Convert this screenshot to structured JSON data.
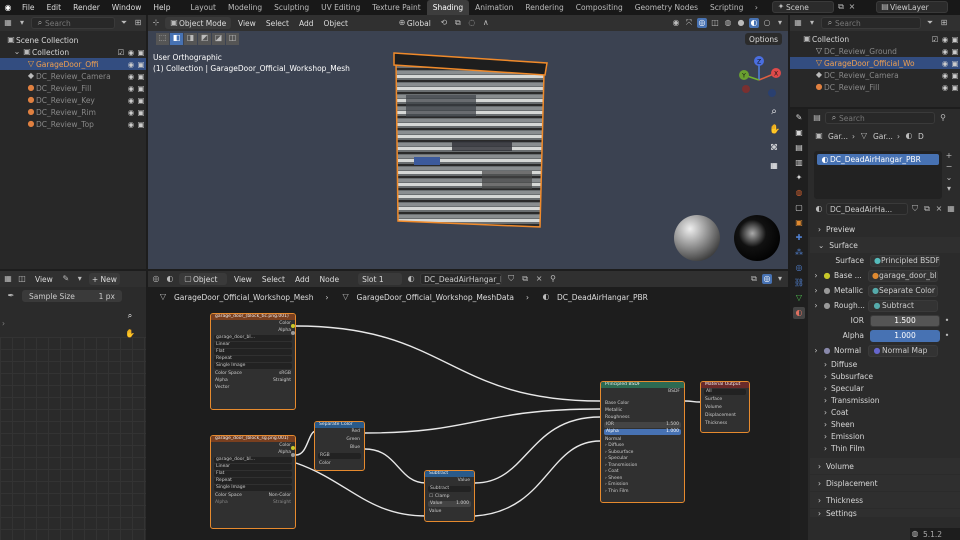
{
  "topbar": {
    "menus": [
      "File",
      "Edit",
      "Render",
      "Window",
      "Help"
    ],
    "workspaces": [
      "Layout",
      "Modeling",
      "Sculpting",
      "UV Editing",
      "Texture Paint",
      "Shading",
      "Animation",
      "Rendering",
      "Compositing",
      "Geometry Nodes",
      "Scripting"
    ],
    "active_workspace": "Shading",
    "scene": "Scene",
    "view_layer": "ViewLayer"
  },
  "left_outliner": {
    "search_placeholder": "Search",
    "items": [
      {
        "label": "Scene Collection",
        "selected": false
      },
      {
        "label": "Collection",
        "selected": false
      },
      {
        "label": "GarageDoor_Offi",
        "selected": true
      },
      {
        "label": "DC_Review_Camera",
        "selected": false
      },
      {
        "label": "DC_Review_Fill",
        "selected": false
      },
      {
        "label": "DC_Review_Key",
        "selected": false
      },
      {
        "label": "DC_Review_Rim",
        "selected": false
      },
      {
        "label": "DC_Review_Top",
        "selected": false
      }
    ]
  },
  "viewport": {
    "mode": "Object Mode",
    "menus": [
      "View",
      "Select",
      "Add",
      "Object"
    ],
    "orientation": "Global",
    "view_name": "User Orthographic",
    "collection_info": "(1) Collection | GarageDoor_Official_Workshop_Mesh",
    "options_label": "Options",
    "gizmo_axes": [
      "X",
      "Y",
      "Z"
    ]
  },
  "image_editor": {
    "view_label": "View",
    "new_label": "New",
    "sample_size_label": "Sample Size",
    "sample_size_value": "1 px"
  },
  "node_editor": {
    "type": "Object",
    "menus": [
      "View",
      "Select",
      "Add",
      "Node"
    ],
    "slot": "Slot 1",
    "material": "DC_DeadAirHangar_PBR",
    "breadcrumb": [
      "GarageDoor_Official_Workshop_Mesh",
      "GarageDoor_Official_Workshop_MeshData",
      "DC_DeadAirHangar_PBR"
    ],
    "nodes": {
      "tex1": {
        "title": "garage_door_(block_tic.png.001)",
        "out_color": "Color",
        "out_alpha": "Alpha",
        "image": "garage_door_bl...",
        "interp": "Linear",
        "proj": "Flat",
        "ext": "Repeat",
        "src": "Single Image",
        "cs_label": "Color Space",
        "cs": "sRGB",
        "alpha_label": "Alpha",
        "alpha": "Straight",
        "vector": "Vector"
      },
      "tex2": {
        "title": "garage_door_(block_sg.png.001)",
        "out_color": "Color",
        "out_alpha": "Alpha",
        "image": "garage_door_bl...",
        "interp": "Linear",
        "proj": "Flat",
        "ext": "Repeat",
        "src": "Single Image",
        "cs_label": "Color Space",
        "cs": "Non-Color",
        "alpha_label": "Alpha",
        "alpha": "Straight"
      },
      "sep": {
        "title": "Separate Color",
        "red": "Red",
        "green": "Green",
        "blue": "Blue",
        "mode": "RGB",
        "color": "Color"
      },
      "sub": {
        "title": "Subtract",
        "out": "Value",
        "op": "Subtract",
        "clamp": "Clamp",
        "val_label": "Value",
        "val": "1.000",
        "in": "Value"
      },
      "bsdf": {
        "title": "Principled BSDF",
        "out": "BSDF",
        "inputs": [
          "Base Color",
          "Metallic",
          "Roughness"
        ],
        "ior_label": "IOR",
        "ior": "1.500",
        "alpha_label": "Alpha",
        "alpha": "1.000",
        "normal": "Normal",
        "panels": [
          "Diffuse",
          "Subsurface",
          "Specular",
          "Transmission",
          "Coat",
          "Sheen",
          "Emission",
          "Thin Film"
        ]
      },
      "out": {
        "title": "Material Output",
        "target": "All",
        "inputs": [
          "Surface",
          "Volume",
          "Displacement",
          "Thickness"
        ]
      }
    }
  },
  "right_outliner": {
    "search_placeholder": "Search",
    "items": [
      {
        "label": "Collection",
        "selected": false
      },
      {
        "label": "DC_Review_Ground",
        "selected": false
      },
      {
        "label": "GarageDoor_Official_Wo",
        "selected": true
      },
      {
        "label": "DC_Review_Camera",
        "selected": false
      },
      {
        "label": "DC_Review_Fill",
        "selected": false
      }
    ]
  },
  "properties": {
    "search_placeholder": "Search",
    "breadcrumb": [
      "Gar...",
      "Gar...",
      "D"
    ],
    "slot_material": "DC_DeadAirHangar_PBR",
    "material_name": "DC_DeadAirHa...",
    "sections": {
      "preview": "Preview",
      "surface": "Surface",
      "volume": "Volume",
      "displacement": "Displacement",
      "thickness": "Thickness",
      "settings": "Settings"
    },
    "surface_label": "Surface",
    "surface_value": "Principled BSDF",
    "rows": [
      {
        "label": "Base ...",
        "value": "garage_door_bl..."
      },
      {
        "label": "Metallic",
        "value": "Separate Color"
      },
      {
        "label": "Rough...",
        "value": "Subtract"
      }
    ],
    "ior_label": "IOR",
    "ior_value": "1.500",
    "alpha_label": "Alpha",
    "alpha_value": "1.000",
    "normal_label": "Normal",
    "normal_value": "Normal Map",
    "subpanels": [
      "Diffuse",
      "Subsurface",
      "Specular",
      "Transmission",
      "Coat",
      "Sheen",
      "Emission",
      "Thin Film"
    ],
    "version": "5.1.2"
  }
}
